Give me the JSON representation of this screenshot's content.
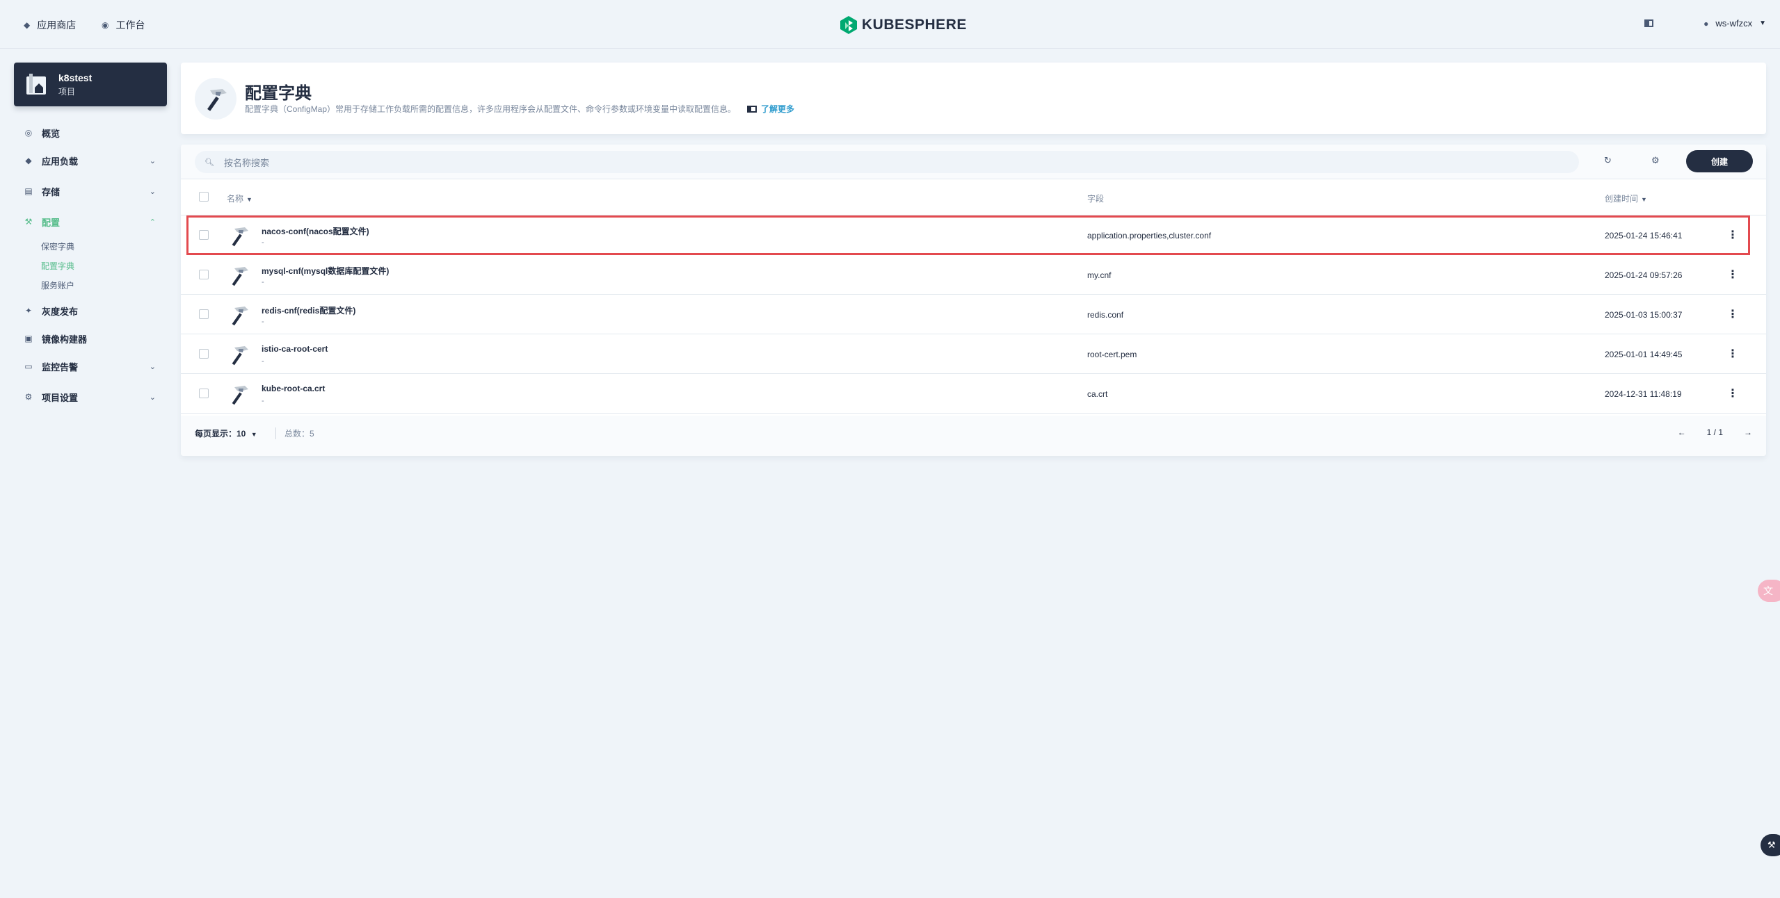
{
  "topbar": {
    "app_store": "应用商店",
    "workbench": "工作台",
    "brand": "KUBESPHERE",
    "user": "ws-wfzcx"
  },
  "project": {
    "name": "k8stest",
    "type": "项目"
  },
  "sidebar": {
    "items": [
      {
        "label": "概览"
      },
      {
        "label": "应用负载"
      },
      {
        "label": "存储"
      },
      {
        "label": "配置"
      },
      {
        "label": "灰度发布"
      },
      {
        "label": "镜像构建器"
      },
      {
        "label": "监控告警"
      },
      {
        "label": "项目设置"
      }
    ],
    "config_sub": [
      {
        "label": "保密字典"
      },
      {
        "label": "配置字典"
      },
      {
        "label": "服务账户"
      }
    ]
  },
  "header": {
    "title": "配置字典",
    "description": "配置字典（ConfigMap）常用于存储工作负载所需的配置信息，许多应用程序会从配置文件、命令行参数或环境变量中读取配置信息。",
    "learn_more": "了解更多"
  },
  "toolbar": {
    "search_placeholder": "按名称搜索",
    "create_label": "创建"
  },
  "table": {
    "columns": {
      "name": "名称",
      "field": "字段",
      "created": "创建时间"
    },
    "rows": [
      {
        "name": "nacos-conf(nacos配置文件)",
        "desc": "-",
        "field": "application.properties,cluster.conf",
        "created": "2025-01-24 15:46:41"
      },
      {
        "name": "mysql-cnf(mysql数据库配置文件)",
        "desc": "-",
        "field": "my.cnf",
        "created": "2025-01-24 09:57:26"
      },
      {
        "name": "redis-cnf(redis配置文件)",
        "desc": "-",
        "field": "redis.conf",
        "created": "2025-01-03 15:00:37"
      },
      {
        "name": "istio-ca-root-cert",
        "desc": "-",
        "field": "root-cert.pem",
        "created": "2025-01-01 14:49:45"
      },
      {
        "name": "kube-root-ca.crt",
        "desc": "-",
        "field": "ca.crt",
        "created": "2024-12-31 11:48:19"
      }
    ]
  },
  "footer": {
    "per_page": "每页显示：10",
    "total": "总数：5",
    "page": "1 / 1"
  },
  "colors": {
    "accent": "#55bc8a",
    "dark": "#242e42",
    "highlight": "#e34a4f",
    "link": "#329dce"
  }
}
